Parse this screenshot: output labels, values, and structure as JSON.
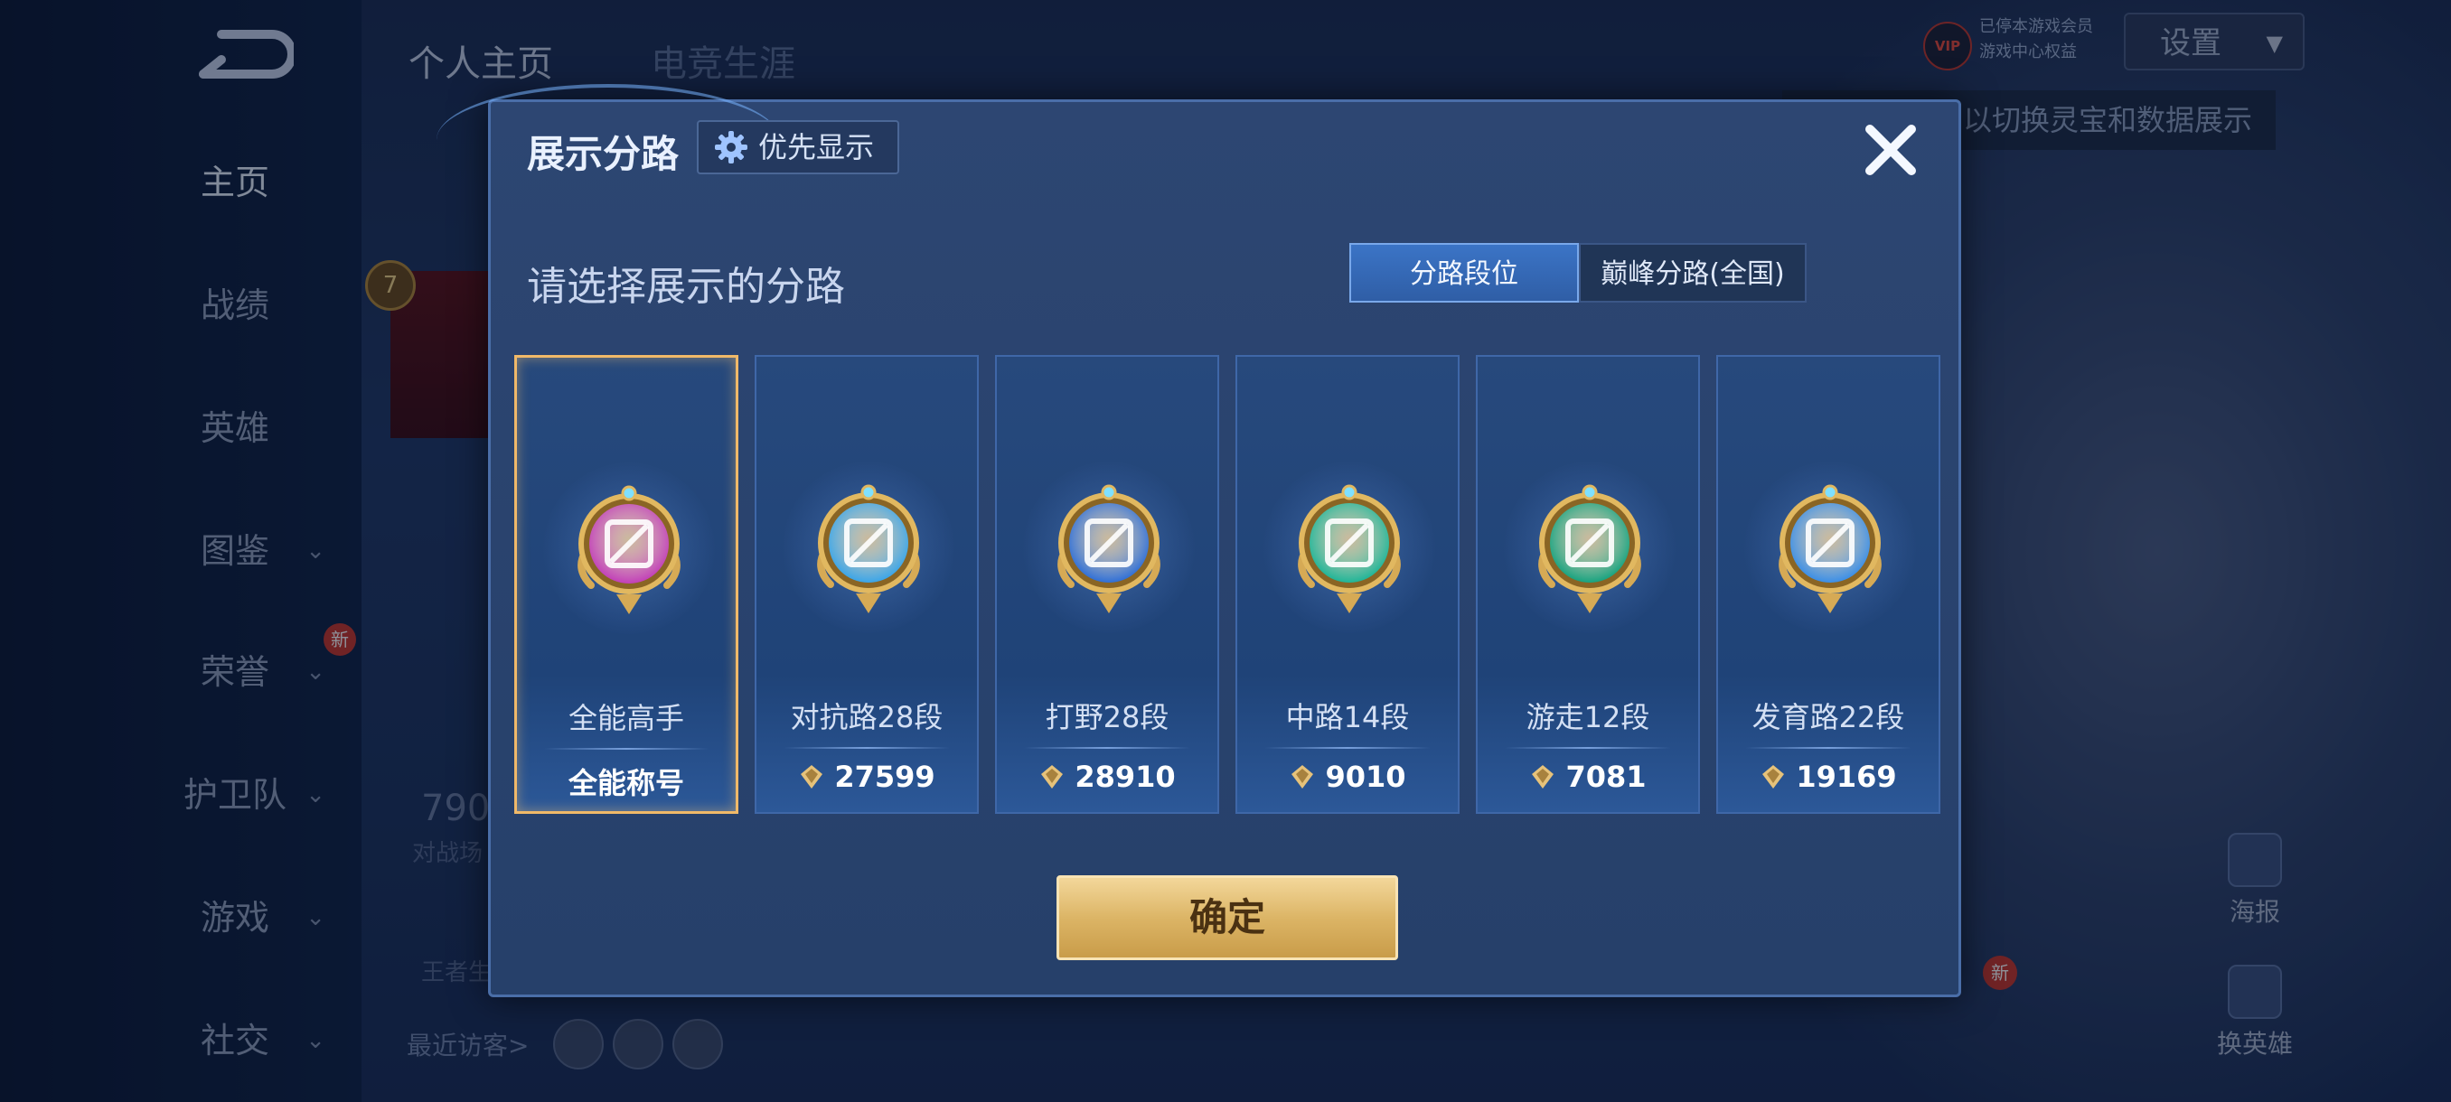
{
  "background": {
    "top_tabs": [
      "个人主页",
      "电竞生涯"
    ],
    "sidebar": [
      {
        "label": "主页",
        "active": true,
        "chevron": false
      },
      {
        "label": "战绩",
        "active": false,
        "chevron": false
      },
      {
        "label": "英雄",
        "active": false,
        "chevron": false
      },
      {
        "label": "图鉴",
        "active": false,
        "chevron": true
      },
      {
        "label": "荣誉",
        "active": false,
        "chevron": true
      },
      {
        "label": "护卫队",
        "active": false,
        "chevron": true
      },
      {
        "label": "游戏",
        "active": false,
        "chevron": true
      },
      {
        "label": "社交",
        "active": false,
        "chevron": true
      }
    ],
    "sidebar_new_badge": "新",
    "settings_label": "设置",
    "vip_label": "VIP",
    "vip_text_line1": "已停本游戏会员",
    "vip_text_line2": "游戏中心权益",
    "tooltip_text": "以切换灵宝和数据展示",
    "level_badge": "7",
    "stat_number": "790",
    "stat_label": "对战场",
    "king_label": "王者生",
    "recent_visitors_label": "最近访客>",
    "right_buttons": [
      "海报",
      "换英雄"
    ],
    "bottom_new_badge": "新"
  },
  "modal": {
    "title": "展示分路",
    "priority_button": "优先显示",
    "subtitle": "请选择展示的分路",
    "segments": [
      "分路段位",
      "巅峰分路(全国)"
    ],
    "active_segment": 0,
    "lanes": [
      {
        "name": "全能高手",
        "score": "全能称号",
        "selected": true,
        "color": "#c23fb8",
        "show_icon": false
      },
      {
        "name": "对抗路28段",
        "score": "27599",
        "selected": false,
        "color": "#3aa5e8",
        "show_icon": true
      },
      {
        "name": "打野28段",
        "score": "28910",
        "selected": false,
        "color": "#2f6fd6",
        "show_icon": true
      },
      {
        "name": "中路14段",
        "score": "9010",
        "selected": false,
        "color": "#1fb597",
        "show_icon": true
      },
      {
        "name": "游走12段",
        "score": "7081",
        "selected": false,
        "color": "#17a37f",
        "show_icon": true
      },
      {
        "name": "发育路22段",
        "score": "19169",
        "selected": false,
        "color": "#3a8ee6",
        "show_icon": true
      }
    ],
    "confirm_button": "确定",
    "colors": {
      "gold": "#e6c27a",
      "selected_border": "#f0b969",
      "accent": "#3b74c6"
    }
  }
}
